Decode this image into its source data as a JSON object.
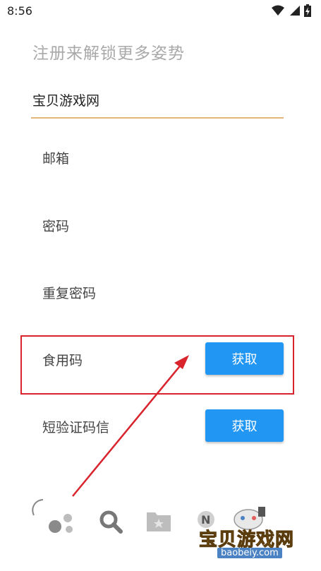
{
  "status_bar": {
    "time": "8:56"
  },
  "heading": "注册来解锁更多姿势",
  "form": {
    "username": "宝贝游戏网",
    "email_placeholder": "邮箱",
    "password_placeholder": "密码",
    "repeat_password_placeholder": "重复密码",
    "food_code_placeholder": "食用码",
    "food_code_button": "获取",
    "sms_code_placeholder": "短验证码信",
    "sms_code_button": "获取"
  },
  "bottom_nav": {
    "icons": [
      "loading-spinner-icon",
      "search-icon",
      "folder-icon",
      "news-icon",
      "game-controller-icon"
    ]
  },
  "watermark": {
    "name": "宝贝游戏网",
    "url": "baobeiy.com"
  },
  "colors": {
    "accent_underline": "#e3b57a",
    "button_blue": "#2196f3",
    "highlight_red": "#d9232d"
  }
}
